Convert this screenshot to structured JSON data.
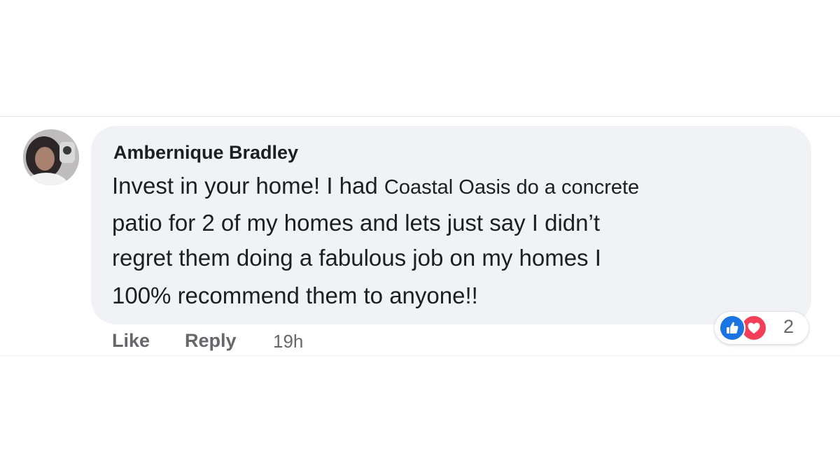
{
  "comment": {
    "author": "Ambernique Bradley",
    "lines": [
      {
        "text": "Invest in your home! I had ",
        "insert": "Coastal Oasis do a concrete"
      },
      {
        "text": "patio for 2 of my homes and lets just say I didn’t"
      },
      {
        "text": "regret them doing a fabulous job on my homes I"
      },
      {
        "text": "100% recommend them to anyone!!"
      }
    ]
  },
  "actions": {
    "like": "Like",
    "reply": "Reply",
    "timestamp": "19h"
  },
  "reactions": {
    "count": "2",
    "icons": [
      "like-icon",
      "love-icon"
    ],
    "colors": {
      "like": "#1b74e4",
      "love": "#f33e58"
    }
  },
  "colors": {
    "bubble": "#f0f2f5",
    "text": "#1c1e21",
    "secondary_text": "#65676b"
  }
}
